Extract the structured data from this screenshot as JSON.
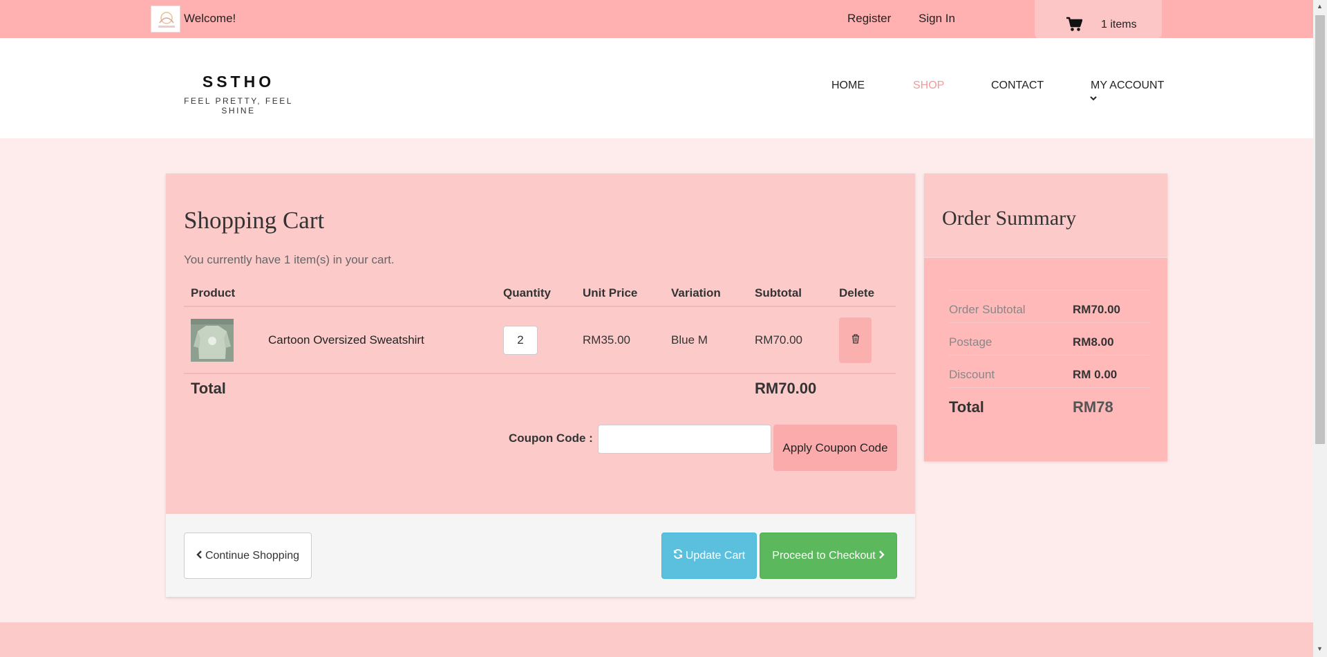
{
  "topbar": {
    "welcome": "Welcome!",
    "register": "Register",
    "sign_in": "Sign In",
    "cart_count": "1 items",
    "cart_icon": "shopping-cart-icon"
  },
  "header": {
    "brand_name": "SSTHO",
    "brand_tagline": "FEEL PRETTY, FEEL SHINE",
    "nav": {
      "home": "HOME",
      "shop": "SHOP",
      "contact": "CONTACT",
      "account": "MY ACCOUNT"
    }
  },
  "cart": {
    "title": "Shopping Cart",
    "subtitle": "You currently have 1 item(s) in your cart.",
    "columns": {
      "product": "Product",
      "quantity": "Quantity",
      "unit_price": "Unit Price",
      "variation": "Variation",
      "subtotal": "Subtotal",
      "delete": "Delete"
    },
    "items": [
      {
        "name": "Cartoon Oversized Sweatshirt",
        "quantity": "2",
        "unit_price": "RM35.00",
        "variation": "Blue M",
        "subtotal": "RM70.00"
      }
    ],
    "total_label": "Total",
    "total_value": "RM70.00",
    "coupon_label": "Coupon Code :",
    "coupon_value": "",
    "apply_coupon": "Apply Coupon Code",
    "continue_shopping": "Continue Shopping",
    "update_cart": "Update Cart",
    "checkout": "Proceed to Checkout"
  },
  "summary": {
    "title": "Order Summary",
    "rows": [
      {
        "label": "Order Subtotal",
        "value": "RM70.00"
      },
      {
        "label": "Postage",
        "value": "RM8.00"
      },
      {
        "label": "Discount",
        "value": "RM 0.00"
      }
    ],
    "total_label": "Total",
    "total_value": "RM78"
  },
  "colors": {
    "topbar": "#ffb0b0",
    "page_bg": "#fdeceb",
    "panel": "#fdcaca",
    "active_nav": "#f09a9a",
    "update_btn": "#5bc0de",
    "checkout_btn": "#5cb85c"
  }
}
